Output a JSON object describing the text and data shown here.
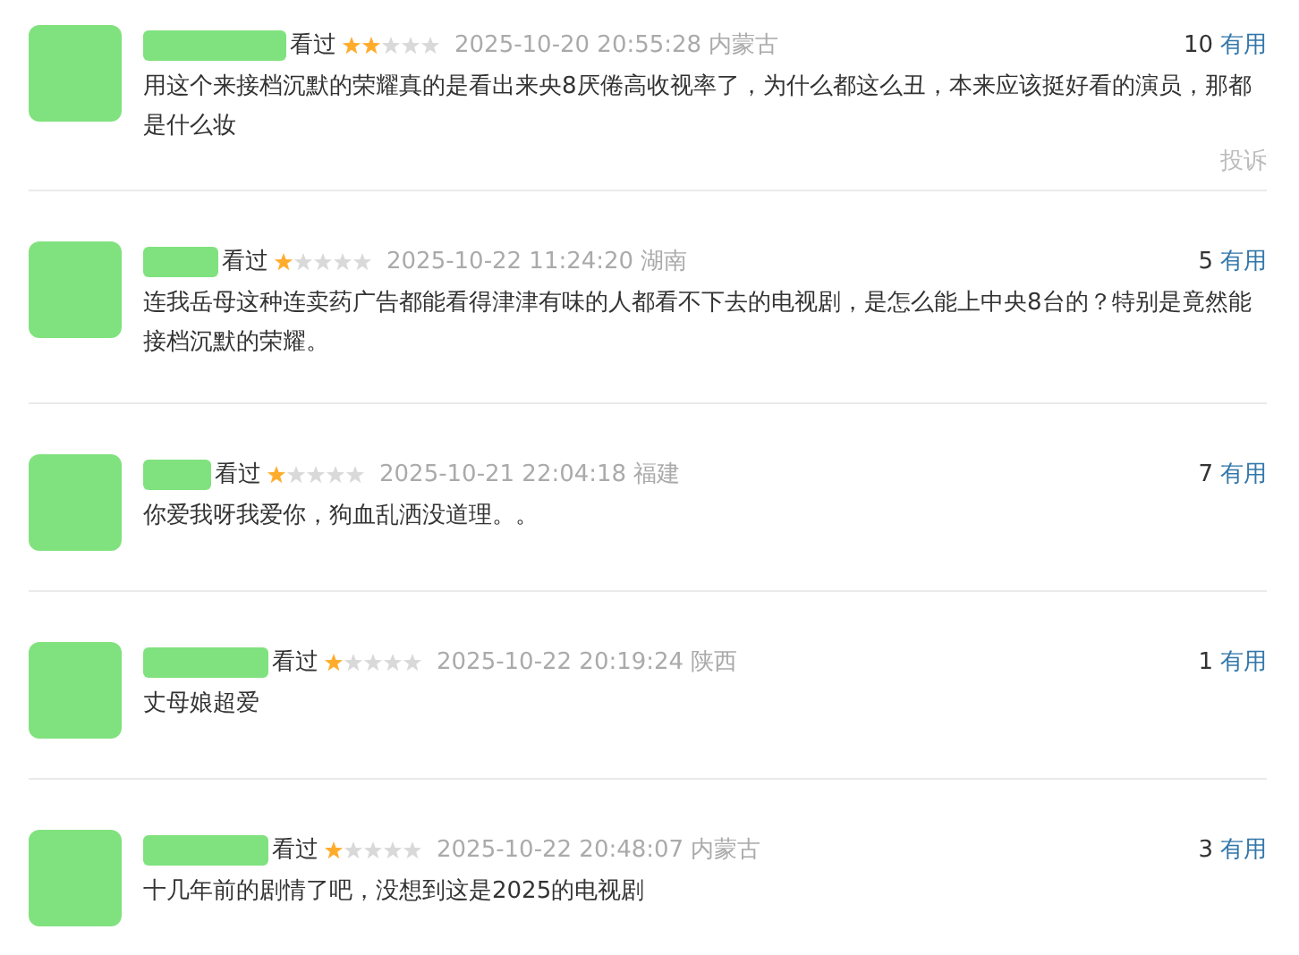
{
  "comments": [
    {
      "status": "看过",
      "stars": 2,
      "time": "2025-10-20 20:55:28",
      "location": "内蒙古",
      "votes": "10",
      "useful": "有用",
      "text": "用这个来接档沉默的荣耀真的是看出来央8厌倦高收视率了，为什么都这么丑，本来应该挺好看的演员，那都是什么妆",
      "report": "投诉"
    },
    {
      "status": "看过",
      "stars": 1,
      "time": "2025-10-22 11:24:20",
      "location": "湖南",
      "votes": "5",
      "useful": "有用",
      "text": "连我岳母这种连卖药广告都能看得津津有味的人都看不下去的电视剧，是怎么能上中央8台的？特别是竟然能接档沉默的荣耀。"
    },
    {
      "status": "看过",
      "stars": 1,
      "time": "2025-10-21 22:04:18",
      "location": "福建",
      "votes": "7",
      "useful": "有用",
      "text": "你爱我呀我爱你，狗血乱洒没道理。。"
    },
    {
      "status": "看过",
      "stars": 1,
      "time": "2025-10-22 20:19:24",
      "location": "陕西",
      "votes": "1",
      "useful": "有用",
      "text": "丈母娘超爱"
    },
    {
      "status": "看过",
      "stars": 1,
      "time": "2025-10-22 20:48:07",
      "location": "内蒙古",
      "votes": "3",
      "useful": "有用",
      "text": "十几年前的剧情了吧，没想到这是2025的电视剧"
    }
  ]
}
